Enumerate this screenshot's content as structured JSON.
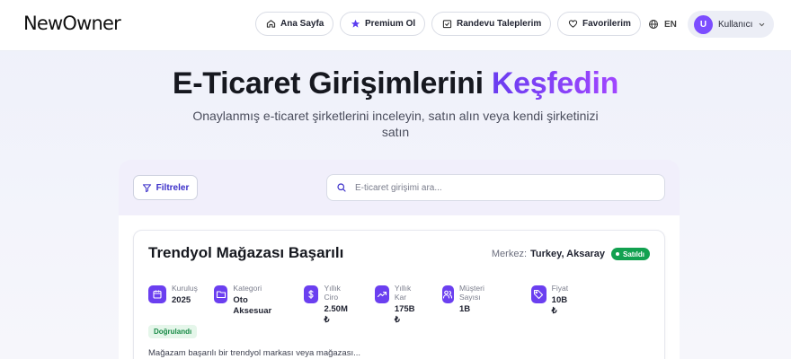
{
  "brand": {
    "logo_text": "NewOwner"
  },
  "nav": {
    "items": [
      {
        "label": "Ana Sayfa",
        "icon": "home-icon"
      },
      {
        "label": "Premium Ol",
        "icon": "star-icon"
      },
      {
        "label": "Randevu Taleplerim",
        "icon": "calendar-check-icon"
      },
      {
        "label": "Favorilerim",
        "icon": "heart-icon"
      }
    ],
    "language": "EN",
    "user": {
      "initial": "U",
      "name": "Kullanıcı"
    }
  },
  "hero": {
    "title_main": "E-Ticaret Girişimlerini ",
    "title_accent": "Keşfedin",
    "subtitle": "Onaylanmış e-ticaret şirketlerini inceleyin, satın alın veya kendi şirketinizi satın"
  },
  "filters": {
    "button_label": "Filtreler",
    "search_placeholder": "E-ticaret girişimi ara..."
  },
  "listing": {
    "title": "Trendyol Mağazası Başarılı",
    "location_label": "Merkez:",
    "location_value": "Turkey, Aksaray",
    "status_badge": "Satıldı",
    "verified_badge": "Doğrulandı",
    "description": "Mağazam başarılı bir trendyol markası veya mağazası...",
    "stats": [
      {
        "label": "Kuruluş",
        "value": "2025",
        "icon": "calendar-icon"
      },
      {
        "label": "Kategori",
        "value": "Oto Aksesuar",
        "icon": "folder-icon"
      },
      {
        "label": "Yıllık Ciro",
        "value": "2.50M ₺",
        "icon": "dollar-icon"
      },
      {
        "label": "Yıllık Kar",
        "value": "175B ₺",
        "icon": "trending-up-icon"
      },
      {
        "label": "Müşteri Sayısı",
        "value": "1B",
        "icon": "users-icon"
      },
      {
        "label": "Fiyat",
        "value": "10B ₺",
        "icon": "tag-icon"
      }
    ]
  },
  "colors": {
    "accent": "#6b3ff0",
    "sold_badge": "#12a150",
    "verified_bg": "#e5f6ea",
    "verified_text": "#178a45"
  }
}
